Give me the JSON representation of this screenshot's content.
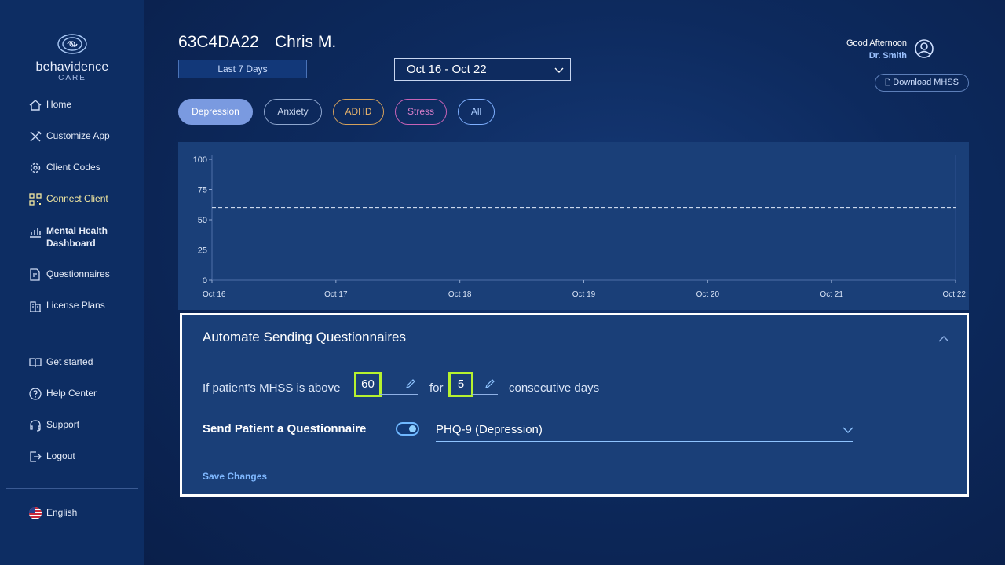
{
  "brand": {
    "name": "behavidence",
    "sub": "CARE"
  },
  "sidebar": {
    "items": [
      {
        "label": "Home",
        "icon": "home-icon"
      },
      {
        "label": "Customize App",
        "icon": "tools-icon"
      },
      {
        "label": "Client Codes",
        "icon": "gear-icon"
      },
      {
        "label": "Connect Client",
        "icon": "qr-icon"
      },
      {
        "label": "Mental Health Dashboard",
        "icon": "bar-chart-icon"
      },
      {
        "label": "Questionnaires",
        "icon": "edit-document-icon"
      },
      {
        "label": "License Plans",
        "icon": "building-icon"
      }
    ],
    "secondary": [
      {
        "label": "Get started",
        "icon": "book-icon"
      },
      {
        "label": "Help Center",
        "icon": "help-icon"
      },
      {
        "label": "Support",
        "icon": "headset-icon"
      },
      {
        "label": "Logout",
        "icon": "logout-icon"
      }
    ],
    "language": "English"
  },
  "header": {
    "client_id": "63C4DA22",
    "client_name": "Chris M.",
    "range_button": "Last 7 Days",
    "date_range": "Oct 16 - Oct 22",
    "greeting": "Good Afternoon",
    "user": "Dr. Smith",
    "download_button": "Download MHSS"
  },
  "filters": [
    "Depression",
    "Anxiety",
    "ADHD",
    "Stress",
    "All"
  ],
  "chart_data": {
    "type": "line",
    "title": "",
    "x": [
      "Oct 16",
      "Oct 17",
      "Oct 18",
      "Oct 19",
      "Oct 20",
      "Oct 21",
      "Oct 22"
    ],
    "series": [],
    "yticks": [
      0,
      25,
      50,
      75,
      100
    ],
    "ylim": [
      0,
      100
    ],
    "threshold": 60,
    "grid": false
  },
  "automation": {
    "title": "Automate Sending Questionnaires",
    "rule_prefix": "If patient's MHSS is above",
    "threshold_value": "60",
    "rule_for": "for",
    "days_value": "5",
    "rule_suffix": "consecutive days",
    "send_label": "Send Patient a Questionnaire",
    "send_enabled": true,
    "questionnaire": "PHQ-9 (Depression)",
    "save_label": "Save Changes"
  },
  "colors": {
    "sidebar_bg": "#0d2d63",
    "panel_bg": "#1a3f78",
    "active_nav": "#f3e8a0",
    "highlight": "#b6f22f",
    "depression": "#7a9ae0",
    "adhd": "#e8b46d",
    "stress": "#d97fcb",
    "all": "#a9ccff"
  }
}
